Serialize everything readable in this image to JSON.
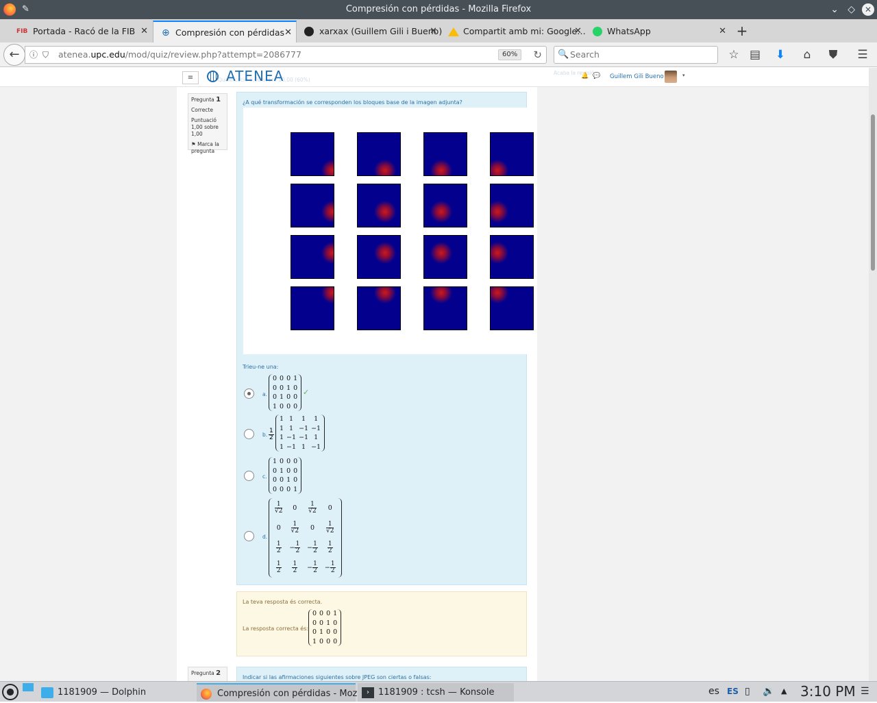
{
  "window": {
    "title": "Compresión con pérdidas - Mozilla Firefox"
  },
  "tabs": [
    {
      "label": "Portada - Racó de la FIB",
      "icon": "fib-icon",
      "active": false
    },
    {
      "label": "Compresión con pérdidas",
      "icon": "globe-icon",
      "active": true
    },
    {
      "label": "xarxax (Guillem Gili i Bueno)",
      "icon": "github-icon",
      "active": false
    },
    {
      "label": "Compartit amb mi: Google…",
      "icon": "google-drive-icon",
      "active": false
    },
    {
      "label": "WhatsApp",
      "icon": "whatsapp-icon",
      "active": false
    }
  ],
  "nav": {
    "url_prefix": "atenea.",
    "url_domain": "upc.edu",
    "url_path": "/mod/quiz/review.php?attempt=2086777",
    "zoom": "60%",
    "search_placeholder": "Search"
  },
  "site": {
    "menu_label": "≡",
    "logo": "ATENEA",
    "ghost_left": "Qualificació   6,00 sobre 10,00 (60%)",
    "ghost_right": "Acaba la revisió",
    "user_name": "Guillem Gili Bueno"
  },
  "question1": {
    "label": "Pregunta",
    "number": "1",
    "state": "Correcte",
    "score": "Puntuació 1,00 sobre 1,00",
    "flag": "Marca la pregunta",
    "text": "¿A qué transformación se corresponden los bloques base de la imagen adjunta?",
    "choose": "Trieu-ne una:",
    "options": [
      {
        "letter": "a.",
        "selected": true,
        "rows": [
          [
            "0",
            "0",
            "0",
            "1"
          ],
          [
            "0",
            "0",
            "1",
            "0"
          ],
          [
            "0",
            "1",
            "0",
            "0"
          ],
          [
            "1",
            "0",
            "0",
            "0"
          ]
        ]
      },
      {
        "letter": "b.",
        "selected": false,
        "prefix_num": "1",
        "prefix_den": "2",
        "rows": [
          [
            "1",
            "1",
            "1",
            "1"
          ],
          [
            "1",
            "1",
            "−1",
            "−1"
          ],
          [
            "1",
            "−1",
            "−1",
            "1"
          ],
          [
            "1",
            "−1",
            "1",
            "−1"
          ]
        ]
      },
      {
        "letter": "c.",
        "selected": false,
        "rows": [
          [
            "1",
            "0",
            "0",
            "0"
          ],
          [
            "0",
            "1",
            "0",
            "0"
          ],
          [
            "0",
            "0",
            "1",
            "0"
          ],
          [
            "0",
            "0",
            "0",
            "1"
          ]
        ]
      },
      {
        "letter": "d.",
        "selected": false,
        "rows": [
          [
            "1/√2",
            "0",
            "1/√2",
            "0"
          ],
          [
            "0",
            "1/√2",
            "0",
            "1/√2"
          ],
          [
            "1/2",
            "−1/2",
            "−1/2",
            "1/2"
          ],
          [
            "1/2",
            "1/2",
            "−1/2",
            "−1/2"
          ]
        ]
      }
    ]
  },
  "feedback": {
    "message": "La teva resposta és correcta.",
    "correct_label": "La resposta correcta és:",
    "rows": [
      [
        "0",
        "0",
        "0",
        "1"
      ],
      [
        "0",
        "0",
        "1",
        "0"
      ],
      [
        "0",
        "1",
        "0",
        "0"
      ],
      [
        "1",
        "0",
        "0",
        "0"
      ]
    ]
  },
  "question2": {
    "label": "Pregunta",
    "number": "2",
    "text": "Indicar si las afirmaciones siguientes sobre JPEG son ciertas o falsas:"
  },
  "taskbar": {
    "tasks": [
      "1181909 — Dolphin",
      "Compresión con pérdidas - Mozill…",
      "1181909 : tcsh — Konsole"
    ],
    "lang1": "es",
    "lang2": "ES",
    "clock": "3:10 PM"
  },
  "colors": {
    "accent": "#0a84ff",
    "moodle_blue": "#1f6fb2",
    "question_bg": "#def0f8",
    "feedback_bg": "#fcf8e3",
    "basis_blue": "#04008e",
    "basis_red": "#cc1a1a"
  }
}
